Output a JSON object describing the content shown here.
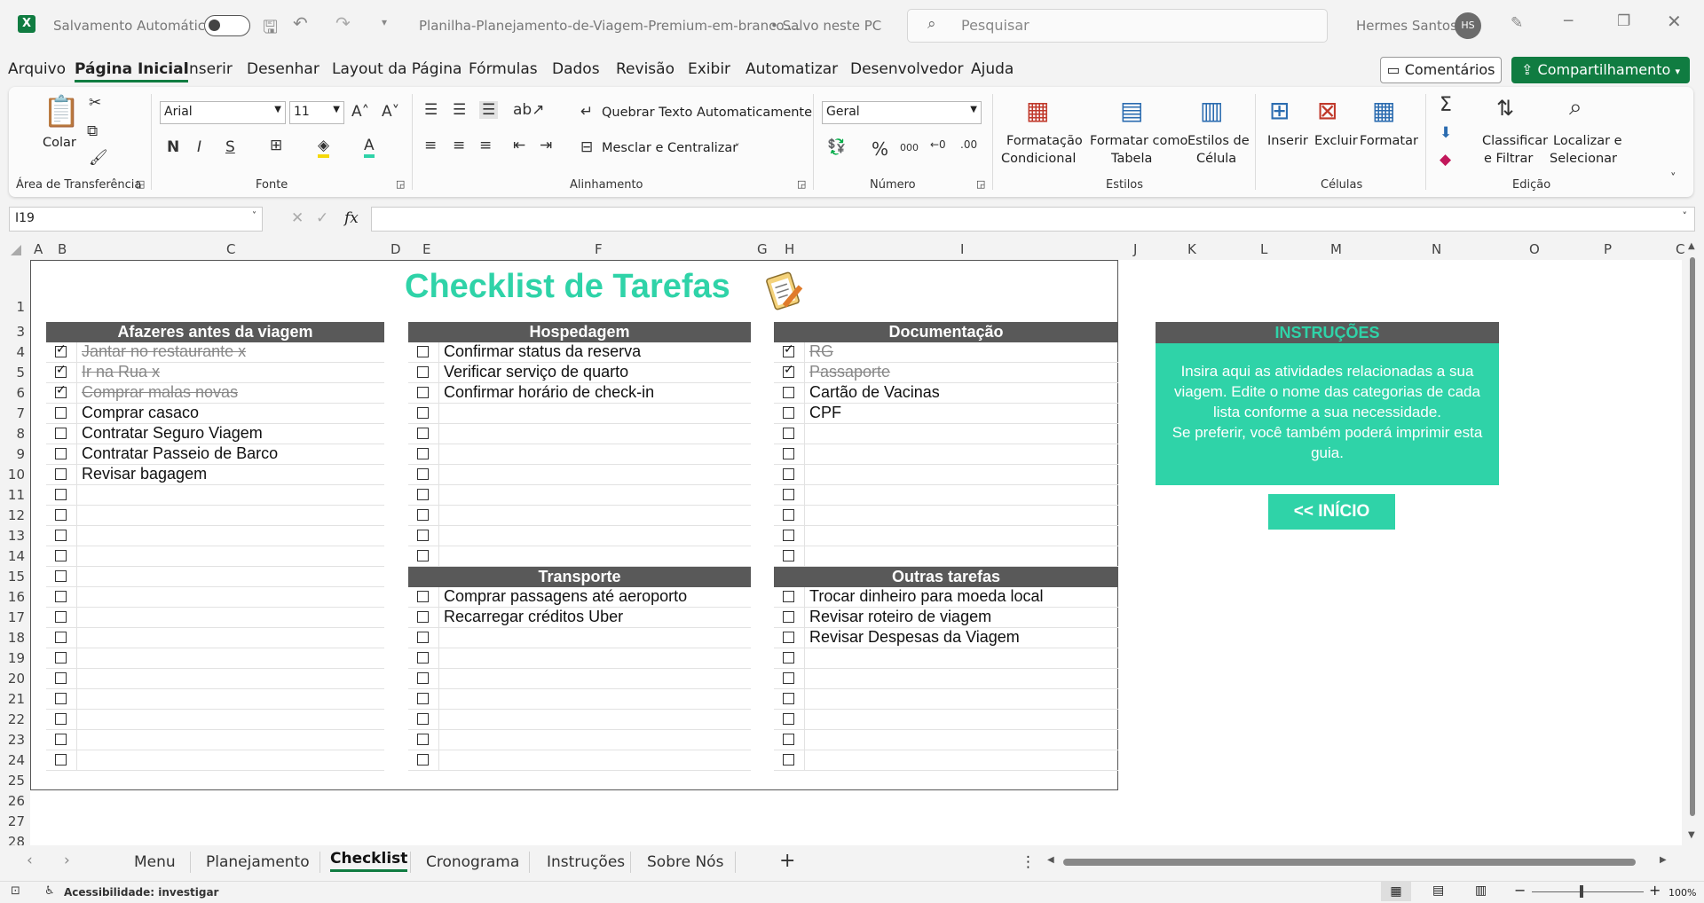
{
  "titlebar": {
    "autosave_label": "Salvamento Automático",
    "doc_name": "Planilha-Planejamento-de-Viagem-Premium-em-branco....",
    "save_status": "• Salvo neste PC",
    "search_placeholder": "Pesquisar",
    "user_name": "Hermes Santos",
    "user_initials": "HS"
  },
  "menu": {
    "items": [
      "Arquivo",
      "Página Inicial",
      "Inserir",
      "Desenhar",
      "Layout da Página",
      "Fórmulas",
      "Dados",
      "Revisão",
      "Exibir",
      "Automatizar",
      "Desenvolvedor",
      "Ajuda"
    ],
    "comments_label": "Comentários",
    "share_label": "Compartilhamento"
  },
  "ribbon": {
    "paste_label": "Colar",
    "group_clipboard": "Área de Transferência",
    "font_name": "Arial",
    "font_size": "11",
    "bold": "N",
    "italic": "I",
    "underline": "S",
    "group_font": "Fonte",
    "wrap_text": "Quebrar Texto Automaticamente",
    "merge_center": "Mesclar e Centralizar",
    "group_alignment": "Alinhamento",
    "number_format": "Geral",
    "percent": "%",
    "thousands": "000",
    "group_number": "Número",
    "cond_format_1": "Formatação",
    "cond_format_2": "Condicional",
    "format_table_1": "Formatar como",
    "format_table_2": "Tabela",
    "cell_styles_1": "Estilos de",
    "cell_styles_2": "Célula",
    "group_styles": "Estilos",
    "insert": "Inserir",
    "delete": "Excluir",
    "format": "Formatar",
    "group_cells": "Células",
    "sort_1": "Classificar",
    "sort_2": "e Filtrar",
    "find_1": "Localizar e",
    "find_2": "Selecionar",
    "group_editing": "Edição"
  },
  "formula_bar": {
    "cell_ref": "I19",
    "fx": "fx",
    "formula": ""
  },
  "columns": [
    "A",
    "B",
    "C",
    "D",
    "E",
    "F",
    "G",
    "H",
    "I",
    "J",
    "K",
    "L",
    "M",
    "N",
    "O",
    "P",
    "C"
  ],
  "rows": [
    "1",
    "3",
    "4",
    "5",
    "6",
    "7",
    "8",
    "9",
    "10",
    "11",
    "12",
    "13",
    "14",
    "15",
    "16",
    "17",
    "18",
    "19",
    "20",
    "21",
    "22",
    "23",
    "24",
    "25",
    "26",
    "27",
    "28"
  ],
  "sheet": {
    "title": "Checklist de Tarefas",
    "sections": [
      {
        "name": "Afazeres antes da viagem",
        "tasks": [
          {
            "text": "Jantar no restaurante x",
            "checked": true
          },
          {
            "text": "Ir na Rua x",
            "checked": true
          },
          {
            "text": "Comprar malas novas",
            "checked": true
          },
          {
            "text": "Comprar casaco",
            "checked": false
          },
          {
            "text": "Contratar Seguro Viagem",
            "checked": false
          },
          {
            "text": "Contratar Passeio de Barco",
            "checked": false
          },
          {
            "text": "Revisar bagagem",
            "checked": false
          }
        ]
      },
      {
        "name": "Hospedagem",
        "tasks": [
          {
            "text": "Confirmar status da reserva",
            "checked": false
          },
          {
            "text": "Verificar serviço de quarto",
            "checked": false
          },
          {
            "text": "Confirmar horário de check-in",
            "checked": false
          }
        ]
      },
      {
        "name": "Documentação",
        "tasks": [
          {
            "text": "RG",
            "checked": true
          },
          {
            "text": "Passaporte",
            "checked": true
          },
          {
            "text": "Cartão de Vacinas",
            "checked": false
          },
          {
            "text": "CPF",
            "checked": false
          }
        ]
      },
      {
        "name": "Transporte",
        "tasks": [
          {
            "text": "Comprar passagens até aeroporto",
            "checked": false
          },
          {
            "text": "Recarregar créditos Uber",
            "checked": false
          }
        ]
      },
      {
        "name": "Outras tarefas",
        "tasks": [
          {
            "text": "Trocar dinheiro para moeda local",
            "checked": false
          },
          {
            "text": "Revisar roteiro de viagem",
            "checked": false
          },
          {
            "text": "Revisar Despesas da Viagem",
            "checked": false
          }
        ]
      }
    ],
    "instructions_title": "INSTRUÇÕES",
    "instructions_lines": [
      "Insira aqui as atividades relacionadas a sua",
      "viagem. Edite o nome das categorias de cada",
      "lista conforme a sua necessidade.",
      "Se preferir, você também poderá imprimir esta",
      "guia."
    ],
    "inicio_button": "<< INÍCIO"
  },
  "tabs": [
    "Menu",
    "Planejamento",
    "Checklist",
    "Cronograma",
    "Instruções",
    "Sobre Nós"
  ],
  "active_tab": "Checklist",
  "status": {
    "accessibility": "Acessibilidade: investigar",
    "zoom": "100%"
  },
  "colors": {
    "accent": "#2fd3a8",
    "header_gray": "#595959",
    "excel_green": "#107c41"
  }
}
